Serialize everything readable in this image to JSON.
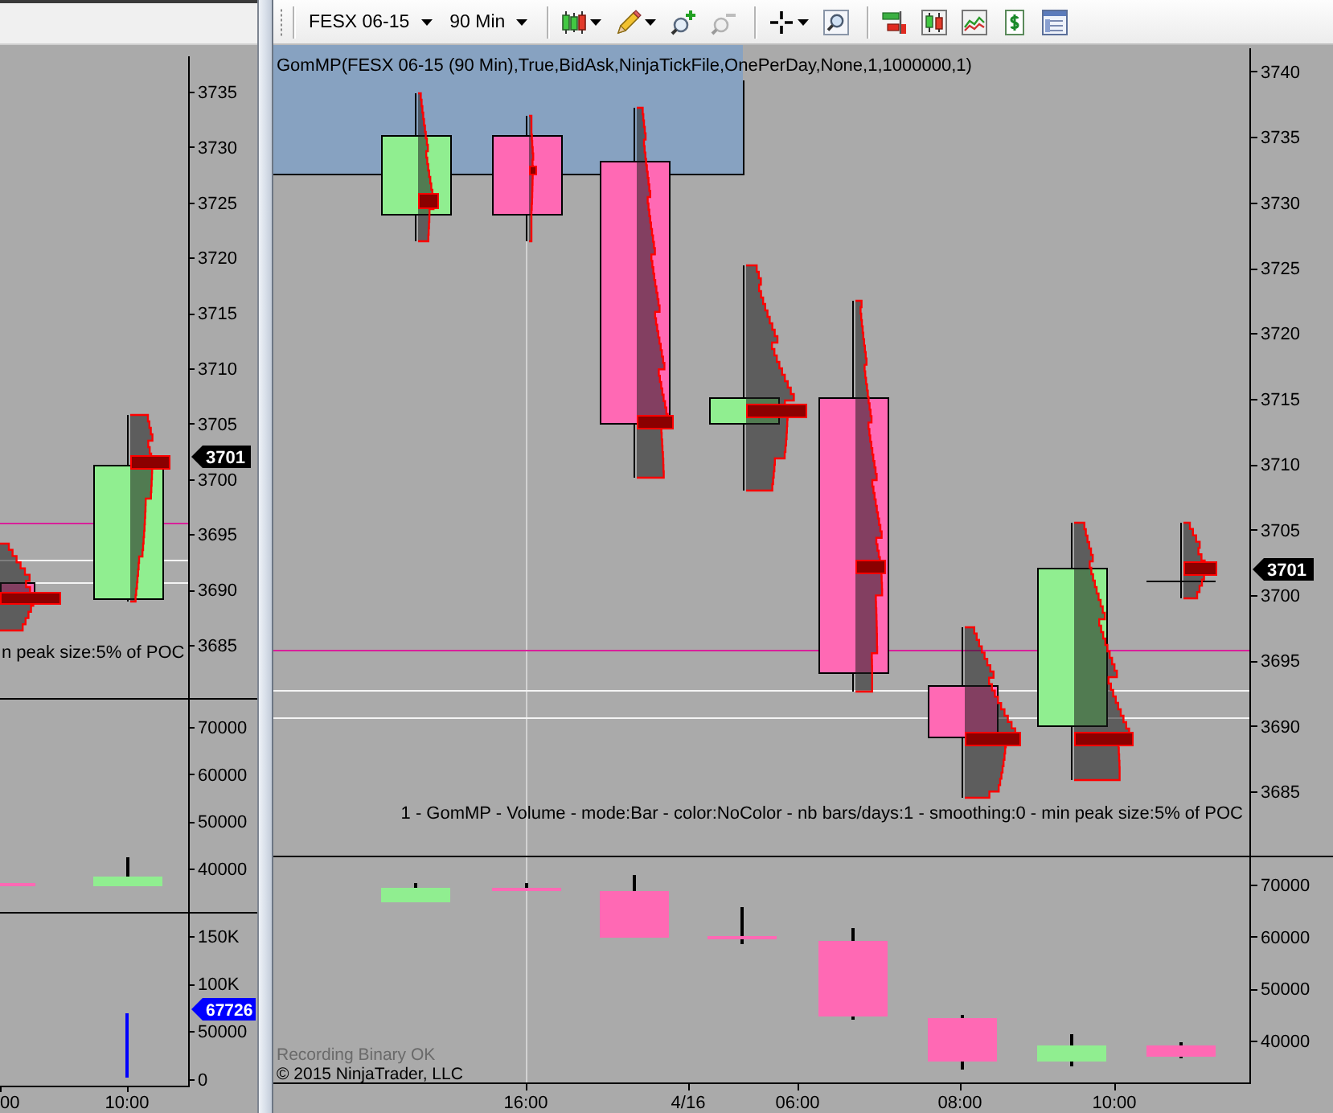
{
  "left_chart": {
    "price_axis": [
      "3735",
      "3730",
      "3725",
      "3720",
      "3715",
      "3710",
      "3705",
      "3700",
      "3695",
      "3690",
      "3685"
    ],
    "price_marker": "3701",
    "indicator_text": "n peak size:5% of POC",
    "volume_axis": [
      "70000",
      "60000",
      "50000",
      "40000"
    ],
    "lower_axis": [
      "150K",
      "100K",
      "50000",
      "0"
    ],
    "lower_marker": "67726",
    "time_axis": [
      "00",
      "10:00"
    ]
  },
  "toolbar": {
    "instrument": "FESX 06-15",
    "interval": "90 Min",
    "tool_groups": [
      [
        {
          "kind": "chartstyle",
          "menu": true,
          "disabled": false
        },
        {
          "kind": "draw",
          "menu": true,
          "disabled": false
        },
        {
          "kind": "zoomin",
          "menu": false,
          "disabled": false
        },
        {
          "kind": "zoomout",
          "menu": false,
          "disabled": true
        }
      ],
      [
        {
          "kind": "crosshair",
          "menu": true,
          "disabled": false
        },
        {
          "kind": "zoombox",
          "menu": false,
          "disabled": false
        }
      ],
      [
        {
          "kind": "dataseries",
          "menu": false,
          "disabled": false
        },
        {
          "kind": "appearance",
          "menu": false,
          "disabled": false
        },
        {
          "kind": "indicators",
          "menu": false,
          "disabled": false
        },
        {
          "kind": "strategies",
          "menu": false,
          "disabled": false
        },
        {
          "kind": "properties",
          "menu": false,
          "disabled": false
        }
      ]
    ]
  },
  "right_chart": {
    "indicator_title": "GomMP(FESX 06-15 (90 Min),True,BidAsk,NinjaTickFile,OnePerDay,None,1,1000000,1)",
    "price_axis": [
      "3740",
      "3735",
      "3730",
      "3725",
      "3720",
      "3715",
      "3710",
      "3705",
      "3700",
      "3695",
      "3690",
      "3685"
    ],
    "price_marker": "3701",
    "indicator_text": "1 - GomMP - Volume - mode:Bar - color:NoColor - nb bars/days:1 - smoothing:0 - min peak size:5% of POC",
    "volume_axis": [
      "70000",
      "60000",
      "50000",
      "40000"
    ],
    "status": "Recording Binary OK",
    "copyright": "© 2015 NinjaTrader, LLC",
    "time_axis": [
      "16:00",
      "4/16",
      "06:00",
      "08:00",
      "10:00"
    ]
  }
}
